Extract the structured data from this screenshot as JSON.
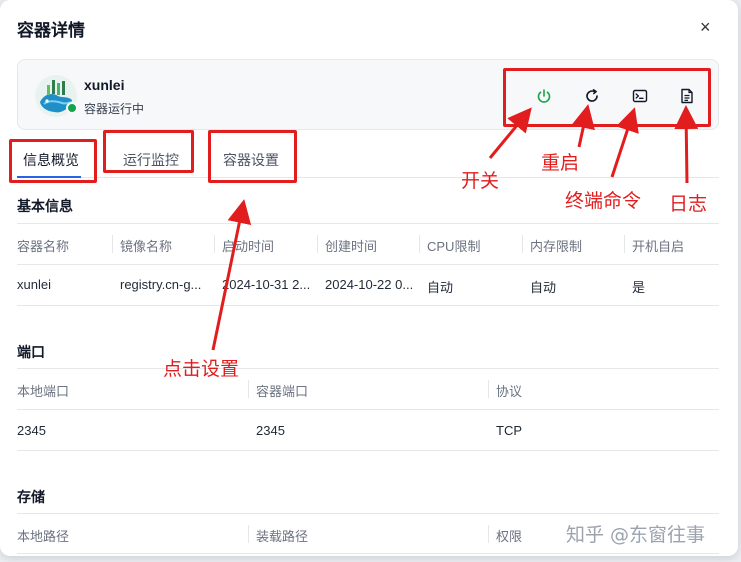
{
  "dialog": {
    "title": "容器详情",
    "close_label": "×"
  },
  "container": {
    "name": "xunlei",
    "status": "容器运行中"
  },
  "actions": [
    {
      "icon": "power-icon",
      "color": "#16a34a"
    },
    {
      "icon": "restart-icon",
      "color": "#111827"
    },
    {
      "icon": "terminal-icon",
      "color": "#111827"
    },
    {
      "icon": "log-document-icon",
      "color": "#111827"
    }
  ],
  "tabs": [
    {
      "label": "信息概览",
      "active": true
    },
    {
      "label": "运行监控",
      "active": false
    },
    {
      "label": "容器设置",
      "active": false
    }
  ],
  "basic": {
    "title": "基本信息",
    "headers": [
      "容器名称",
      "镜像名称",
      "启动时间",
      "创建时间",
      "CPU限制",
      "内存限制",
      "开机自启"
    ],
    "row": [
      "xunlei",
      "registry.cn-g...",
      "2024-10-31 2...",
      "2024-10-22 0...",
      "自动",
      "自动",
      "是"
    ]
  },
  "ports": {
    "title": "端口",
    "headers": [
      "本地端口",
      "容器端口",
      "协议"
    ],
    "row": [
      "2345",
      "2345",
      "TCP"
    ]
  },
  "storage": {
    "title": "存储",
    "headers": [
      "本地路径",
      "装载路径",
      "权限"
    ]
  },
  "annotations": {
    "power": "开关",
    "restart": "重启",
    "terminal": "终端命令",
    "log": "日志",
    "settings": "点击设置"
  },
  "colors": {
    "annotation": "#e11d1d",
    "accent": "#2563eb",
    "running": "#16a34a"
  },
  "watermark": "知乎 @东窗往事"
}
